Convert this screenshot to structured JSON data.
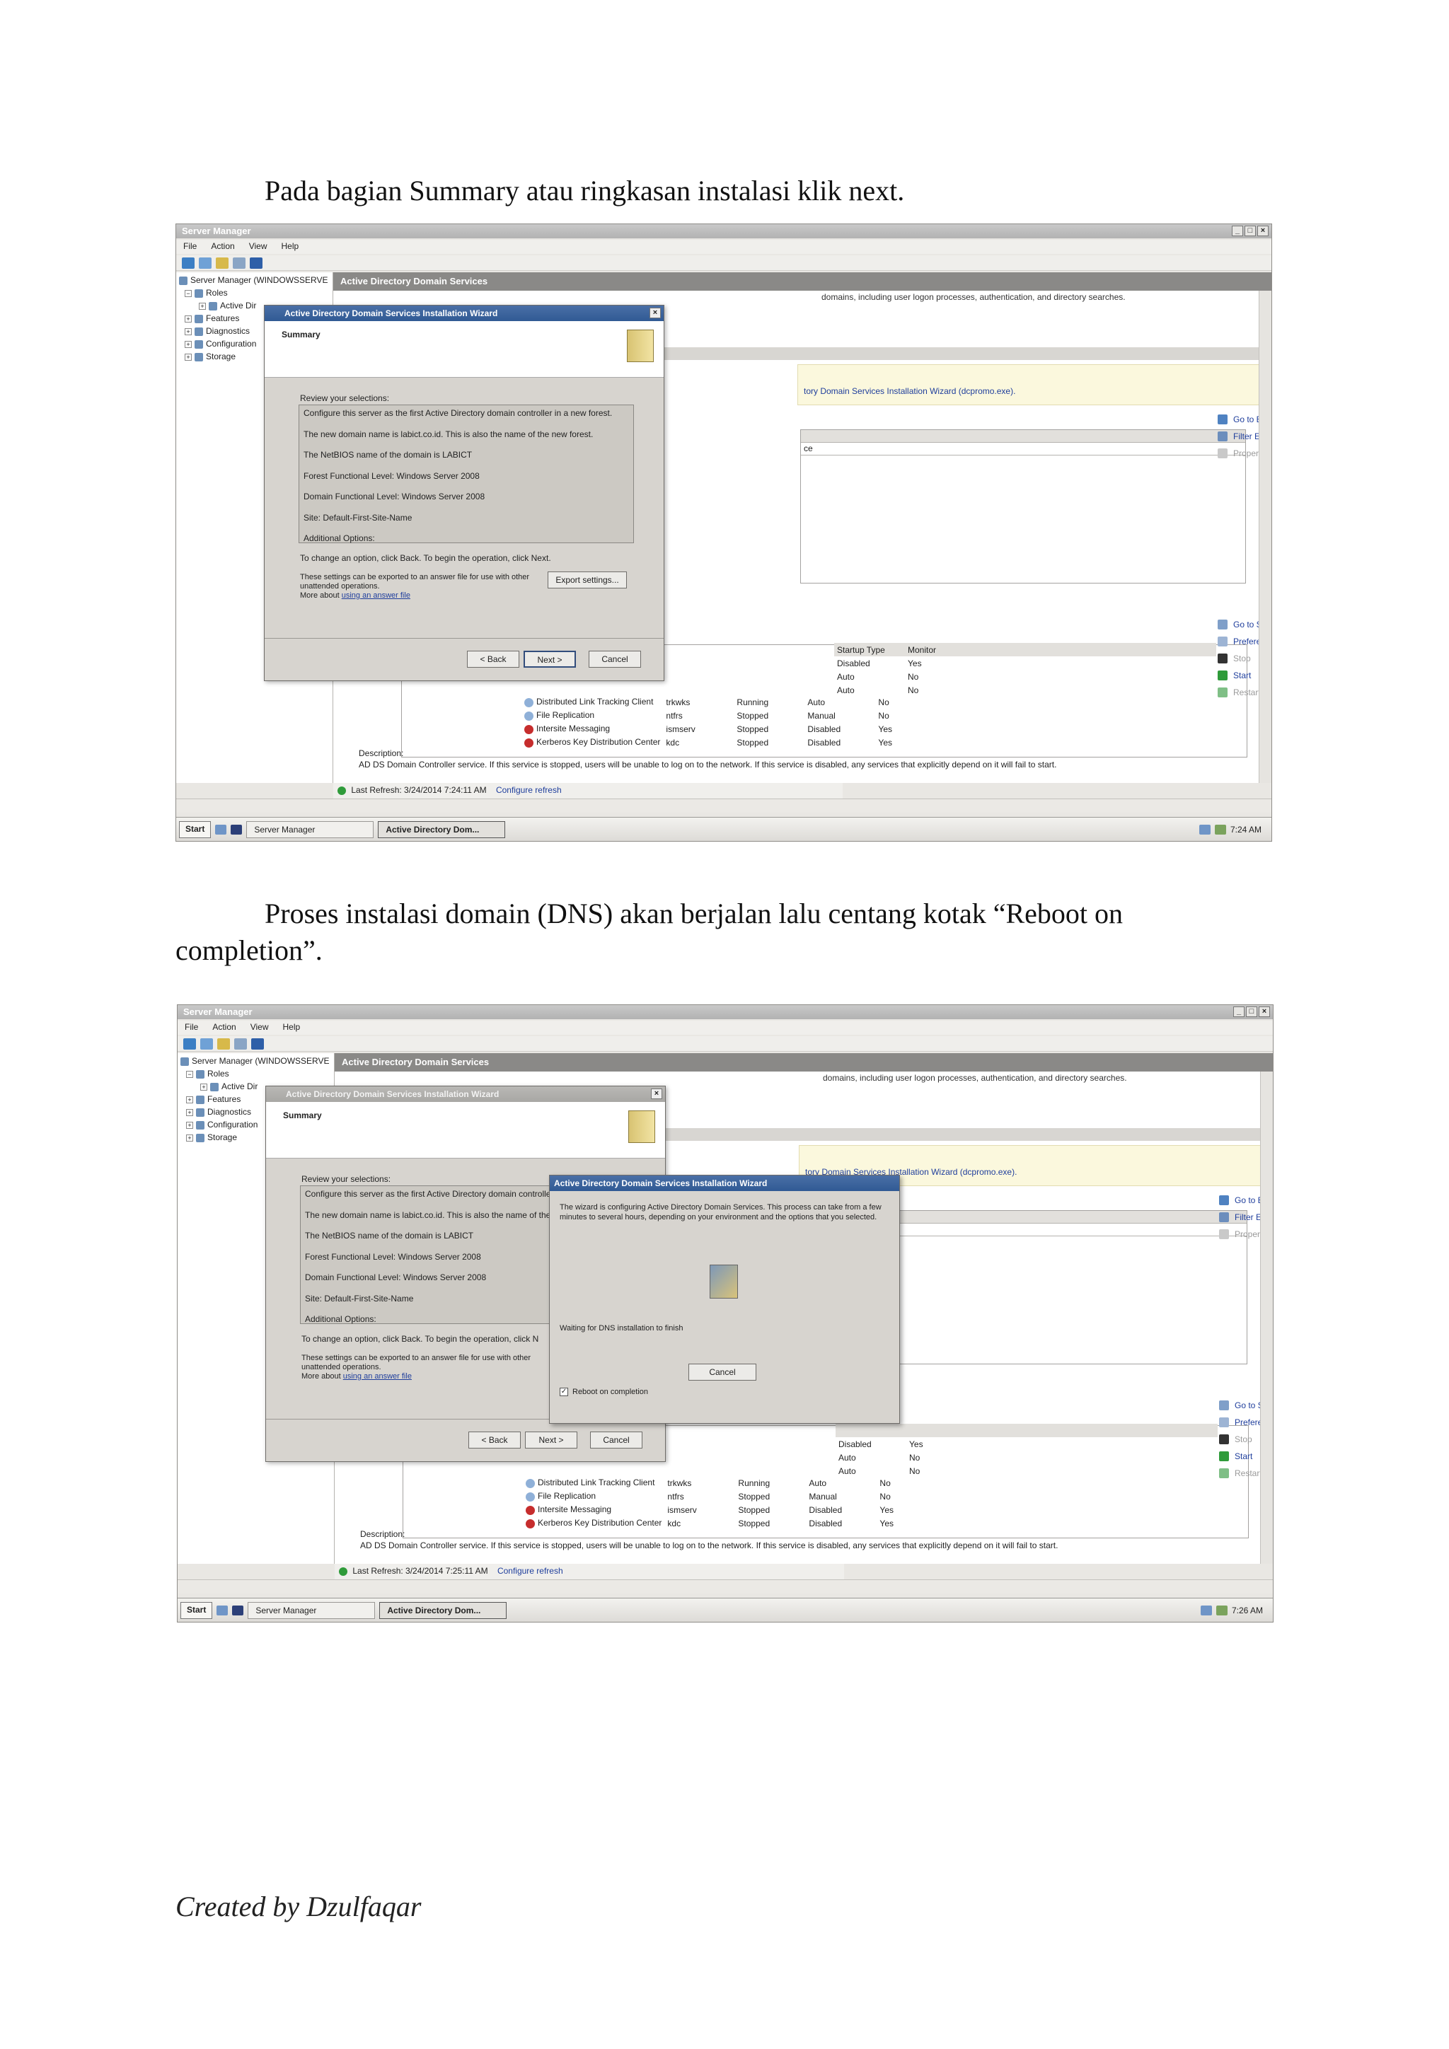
{
  "document": {
    "para1": "Pada bagian Summary atau ringkasan instalasi klik next.",
    "para2_line1": "Proses instalasi domain (DNS) akan berjalan lalu centang kotak “Reboot on",
    "para2_line2": "completion”.",
    "footer": "Created by Dzulfaqar"
  },
  "screenshots": [
    {
      "window_title": "Server Manager",
      "menu": [
        "File",
        "Action",
        "View",
        "Help"
      ],
      "tree": [
        "Server Manager (WINDOWSSERVE",
        "Roles",
        "Active Dir",
        "Features",
        "Diagnostics",
        "Configuration",
        "Storage"
      ],
      "main_header": "Active Directory Domain Services",
      "main_description": "domains, including user logon processes, authentication, and directory searches.",
      "yellow_notice": "tory Domain Services Installation Wizard (dcpromo.exe).",
      "events_actions": [
        "Go to Event Viewer",
        "Filter Events",
        "Properties"
      ],
      "events_col": "ce",
      "services_actions": [
        "Go to Services",
        "Preferences",
        "Stop",
        "Start",
        "Restart"
      ],
      "services_headers": [
        "Startup Type",
        "Monitor"
      ],
      "services_rows_partial": [
        [
          "Disabled",
          "Yes"
        ],
        [
          "Auto",
          "No"
        ],
        [
          "Auto",
          "No"
        ]
      ],
      "services_rows": [
        {
          "name": "Distributed Link Tracking Client",
          "short": "trkwks",
          "status": "Running",
          "startup": "Auto",
          "monitor": "No",
          "state": "run"
        },
        {
          "name": "File Replication",
          "short": "ntfrs",
          "status": "Stopped",
          "startup": "Manual",
          "monitor": "No",
          "state": "run"
        },
        {
          "name": "Intersite Messaging",
          "short": "ismserv",
          "status": "Stopped",
          "startup": "Disabled",
          "monitor": "Yes",
          "state": "stop"
        },
        {
          "name": "Kerberos Key Distribution Center",
          "short": "kdc",
          "status": "Stopped",
          "startup": "Disabled",
          "monitor": "Yes",
          "state": "stop"
        }
      ],
      "description_label": "Description:",
      "description_text": "AD DS Domain Controller service. If this service is stopped, users will be unable to log on to the network. If this service is disabled, any services that explicitly depend on it will fail to start.",
      "last_refresh": "Last Refresh: 3/24/2014 7:24:11 AM",
      "configure_refresh": "Configure refresh",
      "taskbar": {
        "start": "Start",
        "task1": "Server Manager",
        "task2": "Active Directory Dom...",
        "clock": "7:24 AM"
      },
      "wizard": {
        "title": "Active Directory Domain Services Installation Wizard",
        "heading": "Summary",
        "review_label": "Review your selections:",
        "selections": [
          "Configure this server as the first Active Directory domain controller in a new forest.",
          "The new domain name is labict.co.id. This is also the name of the new forest.",
          "The NetBIOS name of the domain is LABICT",
          "Forest Functional Level: Windows Server 2008",
          "Domain Functional Level: Windows Server 2008",
          "Site: Default-First-Site-Name",
          "Additional Options:"
        ],
        "change_text": "To change an option, click Back. To begin the operation, click Next.",
        "export_text": "These settings can be exported to an answer file for use with other unattended operations.",
        "more_about": "More about",
        "answer_link": "using an answer file",
        "export_button": "Export settings...",
        "back_button": "< Back",
        "next_button": "Next >",
        "cancel_button": "Cancel"
      }
    },
    {
      "window_title": "Server Manager",
      "menu": [
        "File",
        "Action",
        "View",
        "Help"
      ],
      "tree": [
        "Server Manager (WINDOWSSERVE",
        "Roles",
        "Active Dir",
        "Features",
        "Diagnostics",
        "Configuration",
        "Storage"
      ],
      "main_header": "Active Directory Domain Services",
      "main_description": "domains, including user logon processes, authentication, and directory searches.",
      "yellow_notice": "tory Domain Services Installation Wizard (dcpromo.exe).",
      "events_actions": [
        "Go to Event Viewer",
        "Filter Events",
        "Properties"
      ],
      "events_col": "",
      "services_actions": [
        "Go to Services",
        "Preferences",
        "Stop",
        "Start",
        "Restart"
      ],
      "services_headers": [
        "",
        ""
      ],
      "services_rows_partial": [
        [
          "Disabled",
          "Yes"
        ],
        [
          "Auto",
          "No"
        ],
        [
          "Auto",
          "No"
        ]
      ],
      "services_rows": [
        {
          "name": "Distributed Link Tracking Client",
          "short": "trkwks",
          "status": "Running",
          "startup": "Auto",
          "monitor": "No",
          "state": "run"
        },
        {
          "name": "File Replication",
          "short": "ntfrs",
          "status": "Stopped",
          "startup": "Manual",
          "monitor": "No",
          "state": "run"
        },
        {
          "name": "Intersite Messaging",
          "short": "ismserv",
          "status": "Stopped",
          "startup": "Disabled",
          "monitor": "Yes",
          "state": "stop"
        },
        {
          "name": "Kerberos Key Distribution Center",
          "short": "kdc",
          "status": "Stopped",
          "startup": "Disabled",
          "monitor": "Yes",
          "state": "stop"
        }
      ],
      "description_label": "Description:",
      "description_text": "AD DS Domain Controller service. If this service is stopped, users will be unable to log on to the network. If this service is disabled, any services that explicitly depend on it will fail to start.",
      "last_refresh": "Last Refresh: 3/24/2014 7:25:11 AM",
      "configure_refresh": "Configure refresh",
      "taskbar": {
        "start": "Start",
        "task1": "Server Manager",
        "task2": "Active Directory Dom...",
        "clock": "7:26 AM"
      },
      "wizard": {
        "title": "Active Directory Domain Services Installation Wizard",
        "heading": "Summary",
        "review_label": "Review your selections:",
        "selections": [
          "Configure this server as the first Active Directory domain controller",
          "The new domain name is labict.co.id. This is also the name of the",
          "The NetBIOS name of the domain is LABICT",
          "Forest Functional Level: Windows Server 2008",
          "Domain Functional Level: Windows Server 2008",
          "Site: Default-First-Site-Name",
          "Additional Options:"
        ],
        "change_text": "To change an option, click Back. To begin the operation, click N",
        "export_text": "These settings can be exported to an answer file for use with other unattended operations.",
        "more_about": "More about",
        "answer_link": "using an answer file",
        "export_button": "",
        "back_button": "< Back",
        "next_button": "Next >",
        "cancel_button": "Cancel"
      },
      "progress": {
        "title": "Active Directory Domain Services Installation Wizard",
        "text": "The wizard is configuring Active Directory Domain Services. This process can take from a few minutes to several hours, depending on your environment and the options that you selected.",
        "waiting": "Waiting for DNS installation to finish",
        "cancel": "Cancel",
        "reboot_label": "Reboot on completion",
        "reboot_checked": true
      }
    }
  ]
}
